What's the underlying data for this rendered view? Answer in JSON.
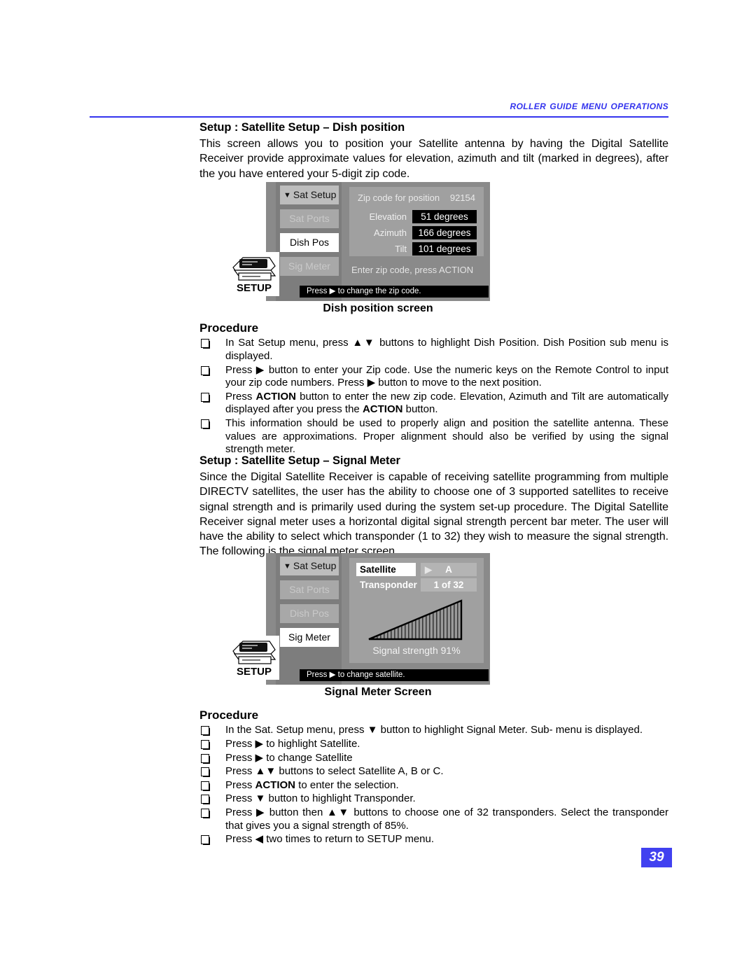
{
  "header": {
    "running_title": "Roller Guide Menu Operations",
    "rule_color": "#3333ee"
  },
  "sections": [
    {
      "heading": "Setup : Satellite Setup – Dish position",
      "body": "This screen allows you to position your Satellite antenna by having the Digital Satellite Receiver provide approximate values for elevation, azimuth and tilt (marked in degrees), after the you have entered your 5-digit zip code."
    },
    {
      "heading": "Setup : Satellite Setup – Signal Meter",
      "body": "Since the Digital Satellite Receiver is capable of receiving satellite programming from multiple DIRECTV satellites, the user has the ability to choose one of 3 supported satellites to receive signal strength and is primarily used during the system set-up procedure. The Digital Satellite Receiver signal meter uses a horizontal digital signal strength percent bar meter. The user will have the ability to select which transponder (1 to 32) they wish to measure the signal strength. The following is the signal meter screen."
    }
  ],
  "dish_screen": {
    "setup_badge_label": "SETUP",
    "menu": [
      {
        "label": "Sat Setup",
        "state": "header",
        "caret": "▼"
      },
      {
        "label": "Sat Ports",
        "state": "disabled"
      },
      {
        "label": "Dish Pos",
        "state": "selected"
      },
      {
        "label": "Sig Meter",
        "state": "disabled"
      }
    ],
    "zip_label": "Zip code for position",
    "zip_value": "92154",
    "fields": [
      {
        "label": "Elevation",
        "value": "51 degrees"
      },
      {
        "label": "Azimuth",
        "value": "166 degrees"
      },
      {
        "label": "Tilt",
        "value": "101 degrees"
      }
    ],
    "hint": "Enter zip code, press ACTION",
    "status": "Press ▶ to change the zip code.",
    "caption": "Dish position screen"
  },
  "meter_screen": {
    "setup_badge_label": "SETUP",
    "menu": [
      {
        "label": "Sat Setup",
        "state": "header",
        "caret": "▼"
      },
      {
        "label": "Sat Ports",
        "state": "disabled"
      },
      {
        "label": "Dish Pos",
        "state": "disabled"
      },
      {
        "label": "Sig Meter",
        "state": "selected"
      }
    ],
    "satellite_label": "Satellite",
    "satellite_value": "A",
    "satellite_arrow": "▶",
    "transponder_label": "Transponder",
    "transponder_value": "1 of 32",
    "signal_label": "Signal strength 91%",
    "status": "Press ▶ to change satellite.",
    "caption": "Signal Meter Screen"
  },
  "procedure_1": {
    "title": "Procedure",
    "steps": [
      "In Sat Setup menu, press  ▲▼ buttons to highlight Dish Position. Dish Position sub menu is displayed.",
      "Press ▶ button to enter your Zip code. Use the numeric keys on the Remote Control to input your zip code numbers. Press ▶ button to move to the next position.",
      "Press ACTION button to enter the new zip code. Elevation, Azimuth and Tilt are automatically displayed after you press the ACTION button.",
      "This information should be used to properly align and position the satellite antenna. These values are approximations. Proper alignment should also be verified by using the signal strength meter."
    ]
  },
  "procedure_2": {
    "title": "Procedure",
    "steps": [
      "In the Sat. Setup menu, press ▼ button to highlight Signal Meter. Sub- menu is displayed.",
      "Press ▶ to highlight Satellite.",
      "Press ▶ to change Satellite",
      "Press ▲▼ buttons to select Satellite A, B or C.",
      "Press ACTION to enter the selection.",
      "Press ▼   button to highlight Transponder.",
      "Press ▶ button then ▲▼ buttons to choose one of 32 transponders. Select the transponder that gives you a signal strength of 85%.",
      "Press ◀ two times to return to SETUP menu."
    ]
  },
  "footer": {
    "page_number": "39"
  }
}
